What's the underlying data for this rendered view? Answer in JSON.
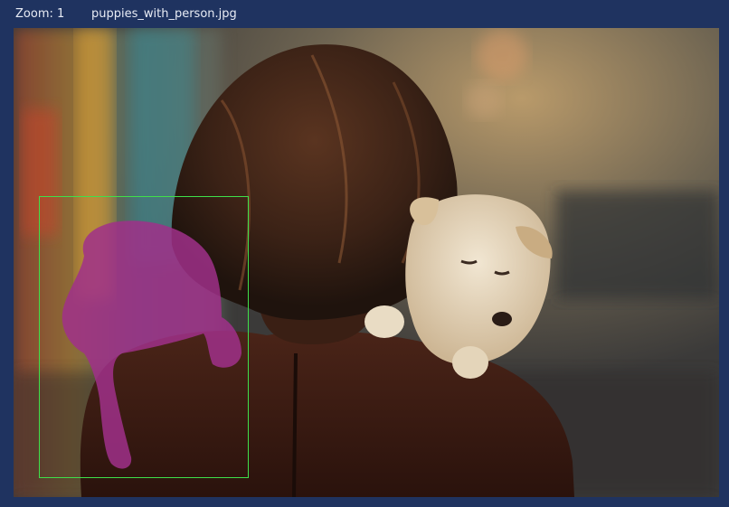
{
  "header": {
    "zoom_label": "Zoom: 1",
    "filename": "puppies_with_person.jpg"
  },
  "annotation": {
    "bbox_color": "#3fe04a",
    "mask_color": "#a0308a"
  },
  "colors": {
    "background": "#1f3360",
    "text": "#e8ecf5"
  }
}
